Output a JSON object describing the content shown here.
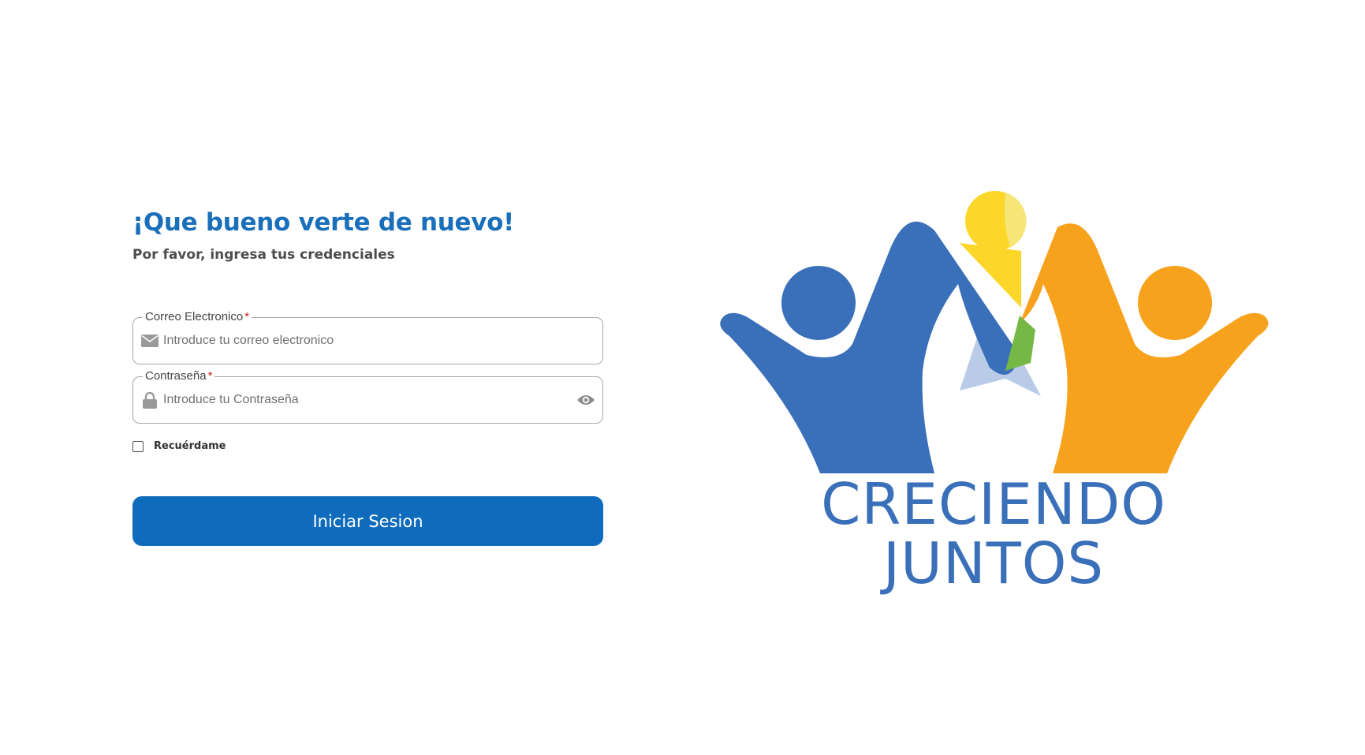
{
  "login": {
    "title": "¡Que bueno verte de nuevo!",
    "subtitle": "Por favor, ingresa tus credenciales",
    "email": {
      "label": "Correo Electronico",
      "required_mark": "*",
      "placeholder": "Introduce tu correo electronico",
      "value": "",
      "icon": "envelope-icon"
    },
    "password": {
      "label": "Contraseña",
      "required_mark": "*",
      "placeholder": "Introduce tu Contraseña",
      "value": "",
      "icon": "lock-icon",
      "toggle_icon": "eye-icon"
    },
    "remember": {
      "label": "Recuérdame",
      "checked": false
    },
    "submit_label": "Iniciar Sesion"
  },
  "logo": {
    "line1": "CRECIENDO",
    "line2": "JUNTOS"
  },
  "colors": {
    "brand_blue": "#1a6fba",
    "button_blue": "#0f6cbd",
    "logo_blue": "#3a6fb9",
    "logo_orange": "#f7a21d",
    "logo_yellow": "#fcd72a",
    "logo_green": "#76b845",
    "required": "#d01b1b"
  }
}
